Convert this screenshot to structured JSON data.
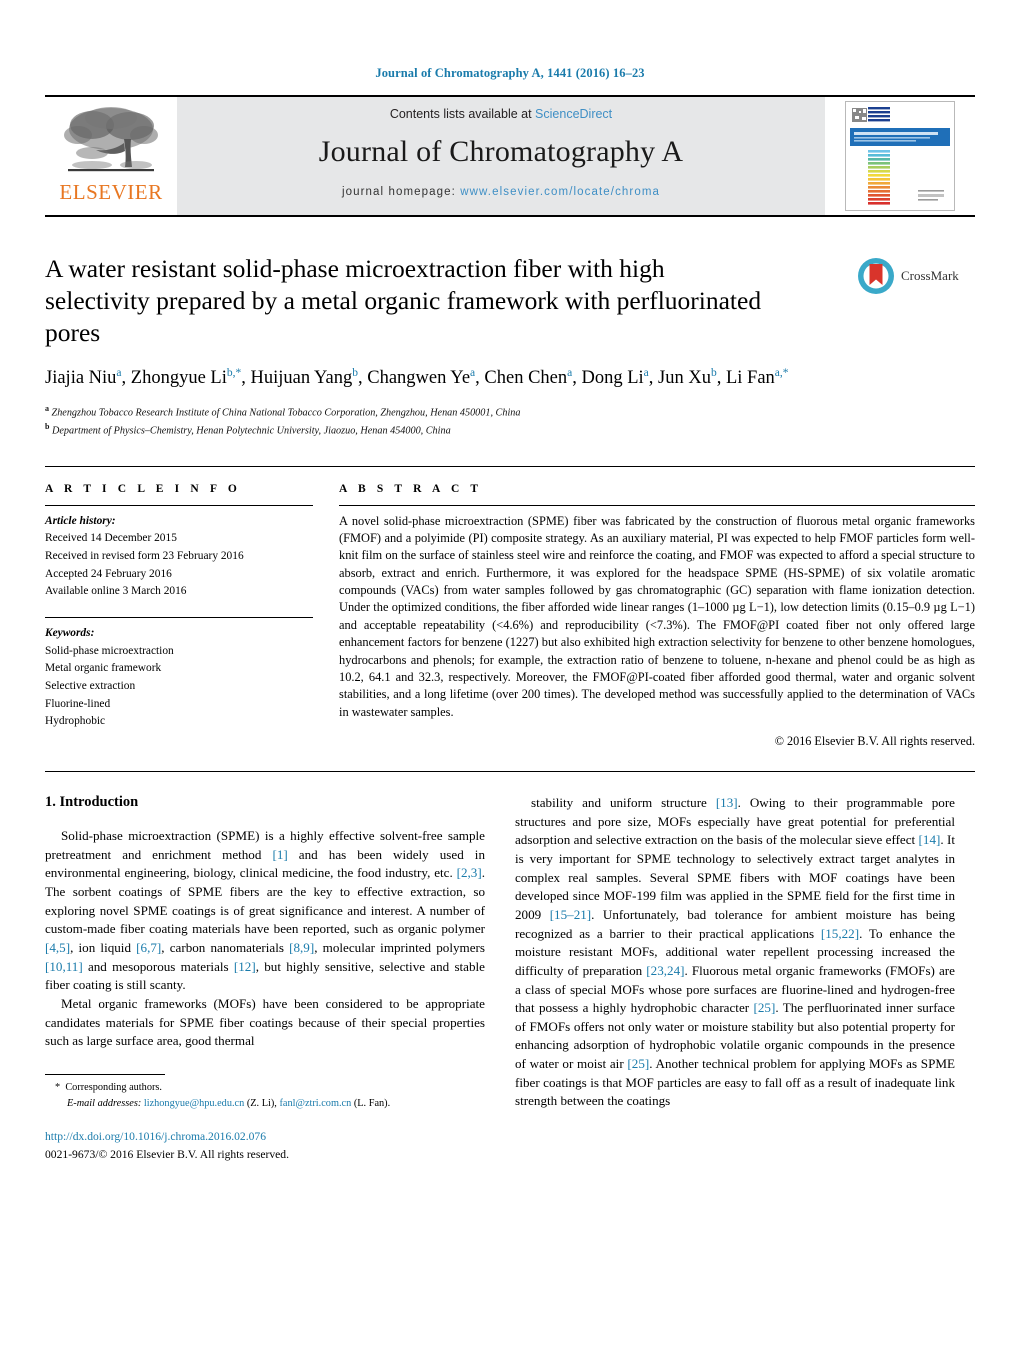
{
  "running_head": "Journal of Chromatography A, 1441 (2016) 16–23",
  "masthead": {
    "publisher_word": "ELSEVIER",
    "contents_prefix": "Contents lists available at ",
    "contents_link": "ScienceDirect",
    "journal_title": "Journal of Chromatography A",
    "homepage_prefix": "journal homepage: ",
    "homepage_url": "www.elsevier.com/locate/chroma",
    "cover_banner_title": "JOURNAL OF CHROMATOGRAPHY A",
    "cover_banner_sub": "INCLUDING ELECTROPHORESIS AND OTHER SEPARATION METHODS"
  },
  "article": {
    "title": "A water resistant solid-phase microextraction fiber with high selectivity prepared by a metal organic framework with perfluorinated pores",
    "crossmark_label": "CrossMark",
    "authors": [
      {
        "name": "Jiajia Niu",
        "sup": "a",
        "sep": ", "
      },
      {
        "name": "Zhongyue Li",
        "sup": "b,*",
        "sep": ", "
      },
      {
        "name": "Huijuan Yang",
        "sup": "b",
        "sep": ", "
      },
      {
        "name": "Changwen Ye",
        "sup": "a",
        "sep": ", "
      },
      {
        "name": "Chen Chen",
        "sup": "a",
        "sep": ", "
      },
      {
        "name": "Dong Li",
        "sup": "a",
        "sep": ", "
      },
      {
        "name": "Jun Xu",
        "sup": "b",
        "sep": ""
      },
      {
        "name": ", Li Fan",
        "sup": "a,*",
        "sep": ""
      }
    ],
    "affiliations": [
      {
        "sup": "a",
        "text": "Zhengzhou Tobacco Research Institute of China National Tobacco Corporation, Zhengzhou, Henan 450001, China"
      },
      {
        "sup": "b",
        "text": "Department of Physics–Chemistry, Henan Polytechnic University, Jiaozuo, Henan 454000, China"
      }
    ]
  },
  "article_info": {
    "heading": "A R T I C L E    I N F O",
    "history_label": "Article history:",
    "history": [
      "Received 14 December 2015",
      "Received in revised form 23 February 2016",
      "Accepted 24 February 2016",
      "Available online 3 March 2016"
    ],
    "keywords_label": "Keywords:",
    "keywords": [
      "Solid-phase microextraction",
      "Metal organic framework",
      "Selective extraction",
      "Fluorine-lined",
      "Hydrophobic"
    ]
  },
  "abstract": {
    "heading": "A B S T R A C T",
    "text": "A novel solid-phase microextraction (SPME) fiber was fabricated by the construction of fluorous metal organic frameworks (FMOF) and a polyimide (PI) composite strategy. As an auxiliary material, PI was expected to help FMOF particles form well-knit film on the surface of stainless steel wire and reinforce the coating, and FMOF was expected to afford a special structure to absorb, extract and enrich. Furthermore, it was explored for the headspace SPME (HS-SPME) of six volatile aromatic compounds (VACs) from water samples followed by gas chromatographic (GC) separation with flame ionization detection. Under the optimized conditions, the fiber afforded wide linear ranges (1–1000 µg L−1), low detection limits (0.15–0.9 µg L−1) and acceptable repeatability (<4.6%) and reproducibility (<7.3%). The FMOF@PI coated fiber not only offered large enhancement factors for benzene (1227) but also exhibited high extraction selectivity for benzene to other benzene homologues, hydrocarbons and phenols; for example, the extraction ratio of benzene to toluene, n-hexane and phenol could be as high as 10.2, 64.1 and 32.3, respectively. Moreover, the FMOF@PI-coated fiber afforded good thermal, water and organic solvent stabilities, and a long lifetime (over 200 times). The developed method was successfully applied to the determination of VACs in wastewater samples.",
    "copyright": "© 2016 Elsevier B.V. All rights reserved."
  },
  "body": {
    "section_title": "1.  Introduction",
    "left_paragraphs": [
      "Solid-phase microextraction (SPME) is a highly effective solvent-free sample pretreatment and enrichment method [1] and has been widely used in environmental engineering, biology, clinical medicine, the food industry, etc. [2,3]. The sorbent coatings of SPME fibers are the key to effective extraction, so exploring novel SPME coatings is of great significance and interest. A number of custom-made fiber coating materials have been reported, such as organic polymer [4,5], ion liquid [6,7], carbon nanomaterials [8,9], molecular imprinted polymers [10,11] and mesoporous materials [12], but highly sensitive, selective and stable fiber coating is still scanty.",
      "Metal organic frameworks (MOFs) have been considered to be appropriate candidates materials for SPME fiber coatings because of their special properties such as large surface area, good thermal"
    ],
    "right_paragraphs": [
      "stability and uniform structure [13]. Owing to their programmable pore structures and pore size, MOFs especially have great potential for preferential adsorption and selective extraction on the basis of the molecular sieve effect [14]. It is very important for SPME technology to selectively extract target analytes in complex real samples. Several SPME fibers with MOF coatings have been developed since MOF-199 film was applied in the SPME field for the first time in 2009 [15–21]. Unfortunately, bad tolerance for ambient moisture has being recognized as a barrier to their practical applications [15,22]. To enhance the moisture resistant MOFs, additional water repellent processing increased the difficulty of preparation [23,24]. Fluorous metal organic frameworks (FMOFs) are a class of special MOFs whose pore surfaces are fluorine-lined and hydrogen-free that possess a highly hydrophobic character [25]. The perfluorinated inner surface of FMOFs offers not only water or moisture stability but also potential property for enhancing adsorption of hydrophobic volatile organic compounds in the presence of water or moist air [25]. Another technical problem for applying MOFs as SPME fiber coatings is that MOF particles are easy to fall off as a result of inadequate link strength between the coatings"
    ]
  },
  "footnote": {
    "star": "*",
    "corresponding": "Corresponding authors.",
    "email_label": "E-mail addresses:",
    "email_1": "lizhongyue@hpu.edu.cn",
    "email_1_owner": "(Z. Li)",
    "email_2": "fanl@ztri.com.cn",
    "email_2_owner": "(L. Fan).",
    "doi": "http://dx.doi.org/10.1016/j.chroma.2016.02.076",
    "issn": "0021-9673/© 2016 Elsevier B.V. All rights reserved."
  },
  "colors": {
    "link": "#1a7bab",
    "elsevier_orange": "#E87722",
    "band_gray": "#e6e7e8"
  }
}
